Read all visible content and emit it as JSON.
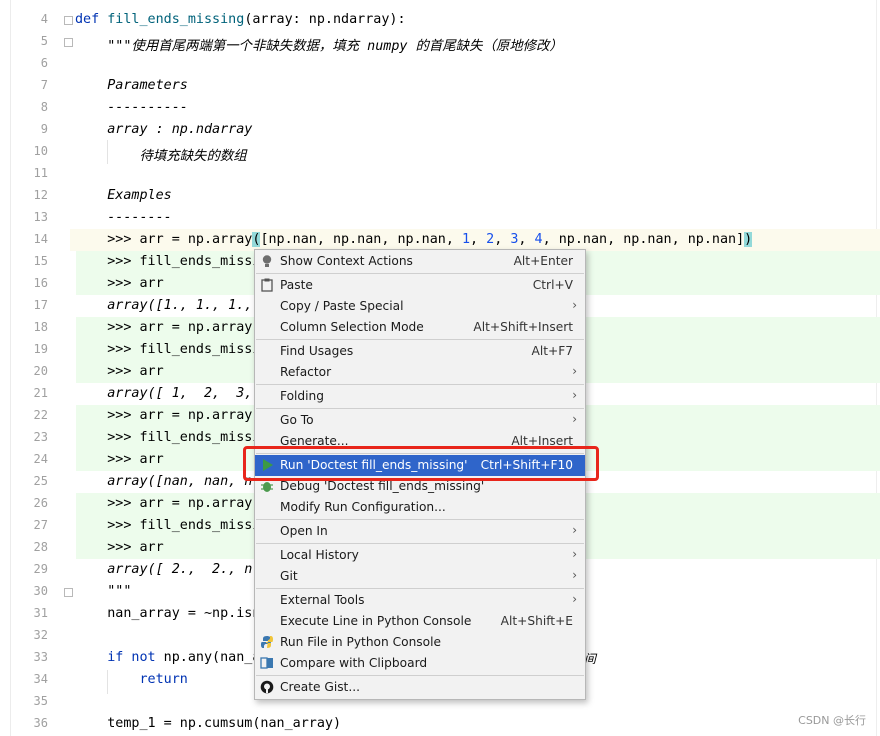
{
  "editor": {
    "lines": [
      {
        "n": "4",
        "t": "def fill_ends_missing(array: np.ndarray):"
      },
      {
        "n": "5",
        "t": "    \"\"\"使用首尾两端第一个非缺失数据，填充 numpy 的首尾缺失（原地修改）"
      },
      {
        "n": "6",
        "t": ""
      },
      {
        "n": "7",
        "t": "    Parameters"
      },
      {
        "n": "8",
        "t": "    ----------"
      },
      {
        "n": "9",
        "t": "    array : np.ndarray"
      },
      {
        "n": "10",
        "t": "        待填充缺失的数组"
      },
      {
        "n": "11",
        "t": ""
      },
      {
        "n": "12",
        "t": "    Examples"
      },
      {
        "n": "13",
        "t": "    --------"
      },
      {
        "n": "14",
        "t": "    >>> arr = np.array([np.nan, np.nan, np.nan, 1, 2, 3, 4, np.nan, np.nan, np.nan])"
      },
      {
        "n": "15",
        "t": "    >>> fill_ends_missi"
      },
      {
        "n": "16",
        "t": "    >>> arr"
      },
      {
        "n": "17",
        "t": "    array([1., 1., 1.,"
      },
      {
        "n": "18",
        "t": "    >>> arr = np.array("
      },
      {
        "n": "19",
        "t": "    >>> fill_ends_missi"
      },
      {
        "n": "20",
        "t": "    >>> arr"
      },
      {
        "n": "21",
        "t": "    array([ 1,  2,  3,"
      },
      {
        "n": "22",
        "t": "    >>> arr = np.array("
      },
      {
        "n": "23",
        "t": "    >>> fill_ends_missi"
      },
      {
        "n": "24",
        "t": "    >>> arr"
      },
      {
        "n": "25",
        "t": "    array([nan, nan, n"
      },
      {
        "n": "26",
        "t": "    >>> arr = np.array("
      },
      {
        "n": "27",
        "t": "    >>> fill_ends_missi"
      },
      {
        "n": "28",
        "t": "    >>> arr"
      },
      {
        "n": "29",
        "t": "    array([ 2.,  2., n"
      },
      {
        "n": "30",
        "t": "    \"\"\""
      },
      {
        "n": "31",
        "t": "    nan_array = ~np.isn"
      },
      {
        "n": "32",
        "t": ""
      },
      {
        "n": "33",
        "t": "    if not np.any(nan_a"
      },
      {
        "n": "34",
        "t": "        return"
      },
      {
        "n": "35",
        "t": ""
      },
      {
        "n": "36",
        "t": "    temp_1 = np.cumsum(nan_array)"
      }
    ],
    "line33_tail": "间"
  },
  "menu": {
    "items": [
      {
        "label": "Show Context Actions",
        "shortcut": "Alt+Enter",
        "icon": "lightbulb-icon"
      },
      {
        "label": "Paste",
        "shortcut": "Ctrl+V",
        "icon": "clipboard-icon"
      },
      {
        "label": "Copy / Paste Special",
        "submenu": true
      },
      {
        "label": "Column Selection Mode",
        "shortcut": "Alt+Shift+Insert"
      },
      {
        "label": "Find Usages",
        "shortcut": "Alt+F7"
      },
      {
        "label": "Refactor",
        "submenu": true
      },
      {
        "label": "Folding",
        "submenu": true
      },
      {
        "label": "Go To",
        "submenu": true
      },
      {
        "label": "Generate...",
        "shortcut": "Alt+Insert"
      },
      {
        "label": "Run 'Doctest fill_ends_missing'",
        "shortcut": "Ctrl+Shift+F10",
        "icon": "run-icon",
        "selected": true
      },
      {
        "label": "Debug 'Doctest fill_ends_missing'",
        "icon": "debug-icon"
      },
      {
        "label": "Modify Run Configuration..."
      },
      {
        "label": "Open In",
        "submenu": true
      },
      {
        "label": "Local History",
        "submenu": true
      },
      {
        "label": "Git",
        "submenu": true
      },
      {
        "label": "External Tools",
        "submenu": true
      },
      {
        "label": "Execute Line in Python Console",
        "shortcut": "Alt+Shift+E"
      },
      {
        "label": "Run File in Python Console",
        "icon": "python-icon"
      },
      {
        "label": "Compare with Clipboard",
        "icon": "compare-icon"
      },
      {
        "label": "Create Gist...",
        "icon": "github-icon"
      }
    ]
  },
  "watermark": "CSDN @长行",
  "colors": {
    "selection": "#2f65ca",
    "highlight_box": "#e8261b",
    "doctest_bg": "#edfcec",
    "run_icon": "#3c9a44"
  }
}
